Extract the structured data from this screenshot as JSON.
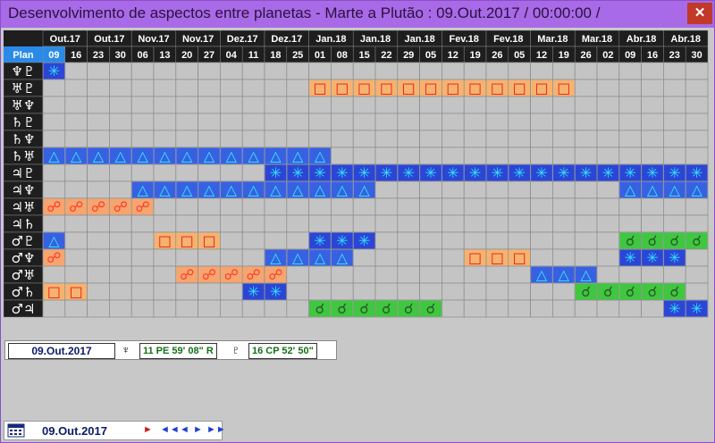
{
  "window": {
    "title": "Desenvolvimento de aspectos entre planetas - Marte a Plutão :  09.Out.2017 /  00:00:00 /",
    "close_label": "✕"
  },
  "corner_label": "Plan",
  "months": [
    {
      "label": "Out.17",
      "span": 2
    },
    {
      "label": "Out.17",
      "span": 2
    },
    {
      "label": "Nov.17",
      "span": 2
    },
    {
      "label": "Nov.17",
      "span": 2
    },
    {
      "label": "Dez.17",
      "span": 2
    },
    {
      "label": "Dez.17",
      "span": 2
    },
    {
      "label": "Jan.18",
      "span": 2
    },
    {
      "label": "Jan.18",
      "span": 2
    },
    {
      "label": "Jan.18",
      "span": 2
    },
    {
      "label": "Fev.18",
      "span": 2
    },
    {
      "label": "Fev.18",
      "span": 2
    },
    {
      "label": "Mar.18",
      "span": 2
    },
    {
      "label": "Mar.18",
      "span": 2
    },
    {
      "label": "Abr.18",
      "span": 2
    },
    {
      "label": "Abr.18",
      "span": 2
    }
  ],
  "days": [
    "09",
    "16",
    "23",
    "30",
    "06",
    "13",
    "20",
    "27",
    "04",
    "11",
    "18",
    "25",
    "01",
    "08",
    "15",
    "22",
    "29",
    "05",
    "12",
    "19",
    "26",
    "05",
    "12",
    "19",
    "26",
    "02",
    "09",
    "16",
    "23",
    "30"
  ],
  "rows": [
    {
      "label": "♆♇",
      "cells": [
        {
          "c": 0,
          "s": "sextile"
        }
      ]
    },
    {
      "label": "♅♇",
      "cells": [
        {
          "c": 12,
          "s": "square"
        },
        {
          "c": 13,
          "s": "square"
        },
        {
          "c": 14,
          "s": "square"
        },
        {
          "c": 15,
          "s": "square"
        },
        {
          "c": 16,
          "s": "square"
        },
        {
          "c": 17,
          "s": "square"
        },
        {
          "c": 18,
          "s": "square"
        },
        {
          "c": 19,
          "s": "square"
        },
        {
          "c": 20,
          "s": "square"
        },
        {
          "c": 21,
          "s": "square"
        },
        {
          "c": 22,
          "s": "square"
        },
        {
          "c": 23,
          "s": "square"
        }
      ]
    },
    {
      "label": "♅♆",
      "cells": []
    },
    {
      "label": "♄♇",
      "cells": []
    },
    {
      "label": "♄♆",
      "cells": []
    },
    {
      "label": "♄♅",
      "cells": [
        {
          "c": 0,
          "s": "trine"
        },
        {
          "c": 1,
          "s": "trine"
        },
        {
          "c": 2,
          "s": "trine"
        },
        {
          "c": 3,
          "s": "trine"
        },
        {
          "c": 4,
          "s": "trine"
        },
        {
          "c": 5,
          "s": "trine"
        },
        {
          "c": 6,
          "s": "trine"
        },
        {
          "c": 7,
          "s": "trine"
        },
        {
          "c": 8,
          "s": "trine"
        },
        {
          "c": 9,
          "s": "trine"
        },
        {
          "c": 10,
          "s": "trine"
        },
        {
          "c": 11,
          "s": "trine"
        },
        {
          "c": 12,
          "s": "trine"
        }
      ]
    },
    {
      "label": "♃♇",
      "cells": [
        {
          "c": 10,
          "s": "sextile"
        },
        {
          "c": 11,
          "s": "sextile"
        },
        {
          "c": 12,
          "s": "sextile"
        },
        {
          "c": 13,
          "s": "sextile"
        },
        {
          "c": 14,
          "s": "sextile"
        },
        {
          "c": 15,
          "s": "sextile"
        },
        {
          "c": 16,
          "s": "sextile"
        },
        {
          "c": 17,
          "s": "sextile"
        },
        {
          "c": 18,
          "s": "sextile"
        },
        {
          "c": 19,
          "s": "sextile"
        },
        {
          "c": 20,
          "s": "sextile"
        },
        {
          "c": 21,
          "s": "sextile"
        },
        {
          "c": 22,
          "s": "sextile"
        },
        {
          "c": 23,
          "s": "sextile"
        },
        {
          "c": 24,
          "s": "sextile"
        },
        {
          "c": 25,
          "s": "sextile"
        },
        {
          "c": 26,
          "s": "sextile"
        },
        {
          "c": 27,
          "s": "sextile"
        },
        {
          "c": 28,
          "s": "sextile"
        },
        {
          "c": 29,
          "s": "sextile"
        }
      ]
    },
    {
      "label": "♃♆",
      "cells": [
        {
          "c": 4,
          "s": "trine"
        },
        {
          "c": 5,
          "s": "trine"
        },
        {
          "c": 6,
          "s": "trine"
        },
        {
          "c": 7,
          "s": "trine"
        },
        {
          "c": 8,
          "s": "trine"
        },
        {
          "c": 9,
          "s": "trine"
        },
        {
          "c": 10,
          "s": "trine"
        },
        {
          "c": 11,
          "s": "trine"
        },
        {
          "c": 12,
          "s": "trine"
        },
        {
          "c": 13,
          "s": "trine"
        },
        {
          "c": 14,
          "s": "trine"
        },
        {
          "c": 26,
          "s": "trine"
        },
        {
          "c": 27,
          "s": "trine"
        },
        {
          "c": 28,
          "s": "trine"
        },
        {
          "c": 29,
          "s": "trine"
        }
      ]
    },
    {
      "label": "♃♅",
      "cells": [
        {
          "c": 0,
          "s": "opposition"
        },
        {
          "c": 1,
          "s": "opposition"
        },
        {
          "c": 2,
          "s": "opposition"
        },
        {
          "c": 3,
          "s": "opposition"
        },
        {
          "c": 4,
          "s": "opposition"
        }
      ]
    },
    {
      "label": "♃♄",
      "cells": []
    },
    {
      "label": "♂♇",
      "cells": [
        {
          "c": 0,
          "s": "trine"
        },
        {
          "c": 5,
          "s": "square"
        },
        {
          "c": 6,
          "s": "square"
        },
        {
          "c": 7,
          "s": "square"
        },
        {
          "c": 12,
          "s": "sextile"
        },
        {
          "c": 13,
          "s": "sextile"
        },
        {
          "c": 14,
          "s": "sextile"
        },
        {
          "c": 26,
          "s": "conjunction"
        },
        {
          "c": 27,
          "s": "conjunction"
        },
        {
          "c": 28,
          "s": "conjunction"
        },
        {
          "c": 29,
          "s": "conjunction"
        }
      ]
    },
    {
      "label": "♂♆",
      "cells": [
        {
          "c": 0,
          "s": "opposition"
        },
        {
          "c": 10,
          "s": "trine"
        },
        {
          "c": 11,
          "s": "trine"
        },
        {
          "c": 12,
          "s": "trine"
        },
        {
          "c": 13,
          "s": "trine"
        },
        {
          "c": 19,
          "s": "square"
        },
        {
          "c": 20,
          "s": "square"
        },
        {
          "c": 21,
          "s": "square"
        },
        {
          "c": 26,
          "s": "sextile"
        },
        {
          "c": 27,
          "s": "sextile"
        },
        {
          "c": 28,
          "s": "sextile"
        }
      ]
    },
    {
      "label": "♂♅",
      "cells": [
        {
          "c": 6,
          "s": "opposition"
        },
        {
          "c": 7,
          "s": "opposition"
        },
        {
          "c": 8,
          "s": "opposition"
        },
        {
          "c": 9,
          "s": "opposition"
        },
        {
          "c": 10,
          "s": "opposition"
        },
        {
          "c": 22,
          "s": "trine"
        },
        {
          "c": 23,
          "s": "trine"
        },
        {
          "c": 24,
          "s": "trine"
        }
      ]
    },
    {
      "label": "♂♄",
      "cells": [
        {
          "c": 0,
          "s": "square"
        },
        {
          "c": 1,
          "s": "square"
        },
        {
          "c": 9,
          "s": "sextile"
        },
        {
          "c": 10,
          "s": "sextile"
        },
        {
          "c": 24,
          "s": "conjunction"
        },
        {
          "c": 25,
          "s": "conjunction"
        },
        {
          "c": 26,
          "s": "conjunction"
        },
        {
          "c": 27,
          "s": "conjunction"
        },
        {
          "c": 28,
          "s": "conjunction"
        }
      ]
    },
    {
      "label": "♂♃",
      "cells": [
        {
          "c": 12,
          "s": "conjunction"
        },
        {
          "c": 13,
          "s": "conjunction"
        },
        {
          "c": 14,
          "s": "conjunction"
        },
        {
          "c": 15,
          "s": "conjunction"
        },
        {
          "c": 16,
          "s": "conjunction"
        },
        {
          "c": 17,
          "s": "conjunction"
        },
        {
          "c": 28,
          "s": "sextile"
        },
        {
          "c": 29,
          "s": "sextile"
        },
        {
          "c": 30,
          "s": "sextile"
        }
      ]
    }
  ],
  "aspect_symbols": {
    "sextile": {
      "glyph": "✳",
      "color": "#30e0ff",
      "bg": "#1030d8"
    },
    "square": {
      "glyph": "□",
      "color": "#e81818",
      "bg": "#ffb060"
    },
    "trine": {
      "glyph": "△",
      "color": "#2af0ff",
      "bg": "#2050e8"
    },
    "opposition": {
      "glyph": "☍",
      "color": "#ff3a2a",
      "bg": "#ffa060"
    },
    "conjunction": {
      "glyph": "☌",
      "color": "#2a5a2a",
      "bg": "#28c828"
    }
  },
  "positions": {
    "date": "09.Out.2017",
    "planet1_glyph": "♆",
    "planet1_pos": "11 PE 59' 08\" R",
    "planet2_glyph": "♇",
    "planet2_pos": "16 CP 52' 50\""
  },
  "statusbar": {
    "date": "09.Out.2017",
    "nav_play": "►",
    "nav_first": "◄◄",
    "nav_prev": "◄",
    "nav_next": "►",
    "nav_last": "►►"
  }
}
